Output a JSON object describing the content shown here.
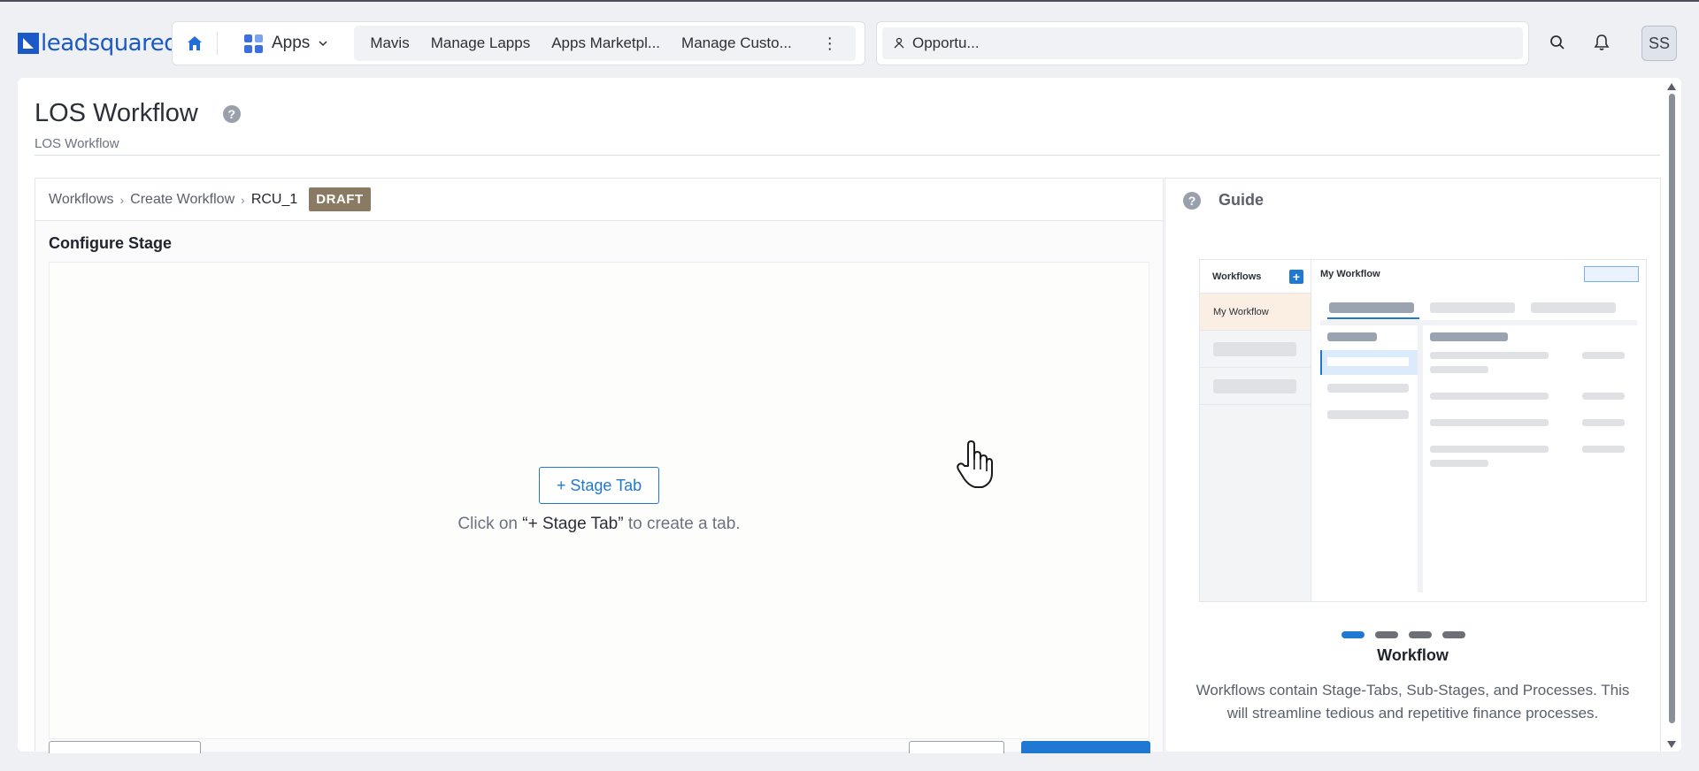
{
  "brand": {
    "logo_text": "leadsquared"
  },
  "nav": {
    "apps_label": "Apps",
    "links": [
      "Mavis",
      "Manage Lapps",
      "Apps Marketpl...",
      "Manage Custo..."
    ],
    "more_label": "⋮"
  },
  "search": {
    "value": "Opportu..."
  },
  "user": {
    "initials": "SS"
  },
  "page": {
    "title": "LOS Workflow",
    "subtitle": "LOS Workflow"
  },
  "breadcrumb": {
    "items": [
      "Workflows",
      "Create Workflow",
      "RCU_1"
    ],
    "status": "DRAFT"
  },
  "stage": {
    "section_title": "Configure Stage",
    "button_label": "+ Stage Tab",
    "hint_prefix": "Click on ",
    "hint_quote": "“+ Stage Tab”",
    "hint_suffix": " to create a tab."
  },
  "guide": {
    "title": "Guide",
    "illustration": {
      "sidebar_title": "Workflows",
      "sidebar_item": "My Workflow",
      "content_title": "My Workflow"
    },
    "slide_count": 4,
    "active_slide": 1,
    "slide_title": "Workflow",
    "slide_text_1": "Workflows contain Stage-Tabs, Sub-Stages, and Processes. This",
    "slide_text_2": "will streamline tedious and repetitive finance processes."
  },
  "colors": {
    "accent": "#1f78d1",
    "brand": "#1b59c6",
    "draft_badge": "#8b7a63"
  }
}
